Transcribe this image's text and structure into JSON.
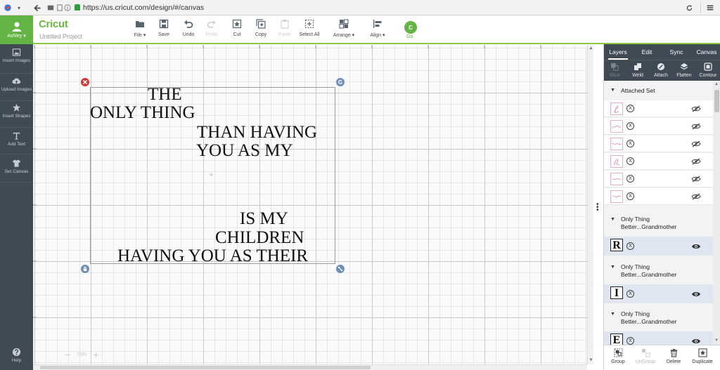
{
  "browser": {
    "url": "https://us.cricut.com/design/#/canvas"
  },
  "header": {
    "user_name": "Ashley",
    "logo": "Cricut",
    "project_name": "Untitled Project",
    "toolbar": [
      {
        "id": "file",
        "label": "File",
        "icon": "folder-icon",
        "dropdown": true,
        "enabled": true
      },
      {
        "id": "save",
        "label": "Save",
        "icon": "save-icon",
        "dropdown": false,
        "enabled": true
      },
      {
        "id": "undo",
        "label": "Undo",
        "icon": "undo-icon",
        "dropdown": false,
        "enabled": true
      },
      {
        "id": "redo",
        "label": "Redo",
        "icon": "redo-icon",
        "dropdown": false,
        "enabled": false
      },
      {
        "id": "cut",
        "label": "Cut",
        "icon": "cut-icon",
        "dropdown": false,
        "enabled": true
      },
      {
        "id": "copy",
        "label": "Copy",
        "icon": "copy-icon",
        "dropdown": false,
        "enabled": true
      },
      {
        "id": "paste",
        "label": "Paste",
        "icon": "paste-icon",
        "dropdown": false,
        "enabled": false
      },
      {
        "id": "select_all",
        "label": "Select All",
        "icon": "select-all-icon",
        "dropdown": false,
        "enabled": true
      },
      {
        "id": "arrange",
        "label": "Arrange",
        "icon": "arrange-icon",
        "dropdown": true,
        "enabled": true
      },
      {
        "id": "align",
        "label": "Align",
        "icon": "align-icon",
        "dropdown": true,
        "enabled": true
      }
    ],
    "go": {
      "label": "Go",
      "icon_text": "C"
    }
  },
  "left_sidebar": {
    "items": [
      {
        "label": "Insert Images",
        "icon": "image-icon"
      },
      {
        "label": "Upload Images",
        "icon": "cloud-upload-icon"
      },
      {
        "label": "Insert Shapes",
        "icon": "shapes-icon"
      },
      {
        "label": "Add Text",
        "icon": "text-icon"
      },
      {
        "label": "Set Canvas",
        "icon": "shirt-icon"
      }
    ],
    "help": {
      "label": "Help",
      "icon": "help-icon"
    }
  },
  "canvas": {
    "text_lines": [
      "THE",
      "ONLY THING",
      "THAN HAVING",
      "YOU AS MY",
      "IS MY",
      "CHILDREN",
      "HAVING YOU AS THEIR"
    ],
    "zoom": {
      "value": "75%"
    }
  },
  "right_panel": {
    "tabs": [
      "Layers",
      "Edit",
      "Sync",
      "Canvas"
    ],
    "active_tab": "Layers",
    "tools": [
      {
        "label": "Slice",
        "icon": "slice-icon",
        "enabled": false
      },
      {
        "label": "Weld",
        "icon": "weld-icon",
        "enabled": true
      },
      {
        "label": "Attach",
        "icon": "attach-icon",
        "enabled": true
      },
      {
        "label": "Flatten",
        "icon": "flatten-icon",
        "enabled": true
      },
      {
        "label": "Contour",
        "icon": "contour-icon",
        "enabled": true
      }
    ],
    "layer_groups": [
      {
        "title": "Attached Set",
        "rows": 6,
        "thumb_kind": "pink-script",
        "eye": "hidden"
      },
      {
        "title": "Only Thing Better...Grandmother",
        "letter": "R",
        "eye": "visible"
      },
      {
        "title": "Only Thing Better...Grandmother",
        "letter": "I",
        "eye": "visible"
      },
      {
        "title": "Only Thing Better...Grandmother",
        "letter": "E",
        "eye": "visible"
      }
    ],
    "bottom_tools": [
      {
        "label": "Group",
        "icon": "group-icon",
        "enabled": true
      },
      {
        "label": "UnGroup",
        "icon": "ungroup-icon",
        "enabled": false
      },
      {
        "label": "Delete",
        "icon": "trash-icon",
        "enabled": true
      },
      {
        "label": "Duplicate",
        "icon": "duplicate-icon",
        "enabled": true
      }
    ]
  },
  "colors": {
    "brand_green": "#63b345",
    "sidebar": "#3f4a55",
    "delete_handle": "#d03a3a",
    "handle_blue": "#6f8fb5",
    "selected_row": "#dfe6f1"
  }
}
